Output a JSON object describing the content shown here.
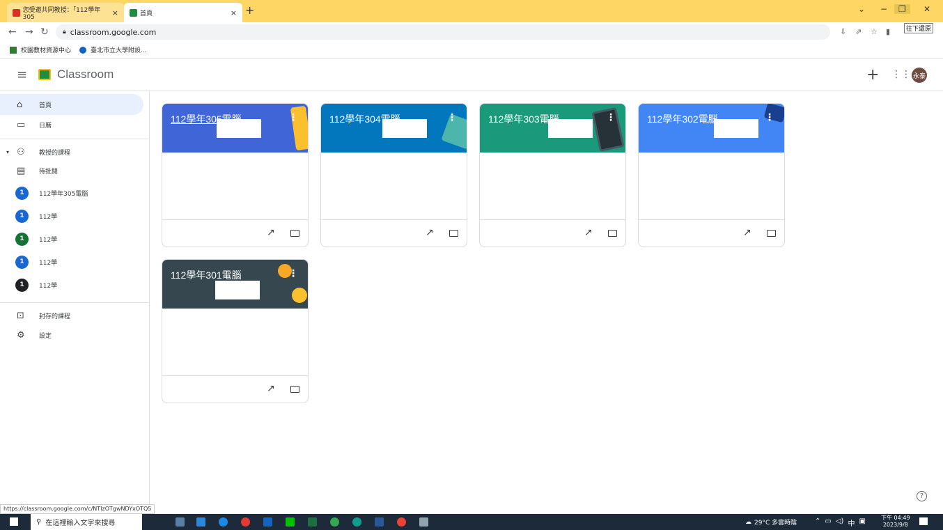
{
  "browser": {
    "tabs": [
      {
        "label": "您受邀共同教授：「112學年305",
        "favicon_color": "#d93025"
      },
      {
        "label": "首頁",
        "favicon_color": "#1e8e3e"
      }
    ],
    "new_tab": "+",
    "url": "classroom.google.com",
    "tooltip": "往下還原",
    "bookmarks": [
      "校園教材資源中心",
      "臺北市立大學附設..."
    ]
  },
  "header": {
    "app_title": "Classroom",
    "avatar_text": "永泰"
  },
  "sidebar": {
    "home": "首頁",
    "calendar": "日曆",
    "teaching": "教授的課程",
    "to_review": "待批閱",
    "classes": [
      {
        "badge": "1",
        "label": "112學年305電腦",
        "color": "#1967d2"
      },
      {
        "badge": "1",
        "label": "112學",
        "color": "#1967d2"
      },
      {
        "badge": "1",
        "label": "112學",
        "color": "#137333"
      },
      {
        "badge": "1",
        "label": "112學",
        "color": "#1967d2"
      },
      {
        "badge": "1",
        "label": "112學",
        "color": "#202124"
      }
    ],
    "archived": "封存的課程",
    "settings": "設定"
  },
  "cards": [
    {
      "title": "112學年305電腦",
      "color": "#4065d6"
    },
    {
      "title": "112學年304電腦",
      "color": "#0277bd"
    },
    {
      "title": "112學年303電腦",
      "color": "#1a9a7a"
    },
    {
      "title": "112學年302電腦",
      "color": "#4285f4"
    },
    {
      "title": "112學年301電腦",
      "color": "#37474f"
    }
  ],
  "status_url": "https://classroom.google.com/c/NTIzOTgwNDYxOTQ5",
  "taskbar": {
    "search_placeholder": "在這裡輸入文字來搜尋",
    "weather": "29°C 多雲時陰",
    "ime": "中",
    "time": "下午 04:49",
    "date": "2023/9/8"
  }
}
